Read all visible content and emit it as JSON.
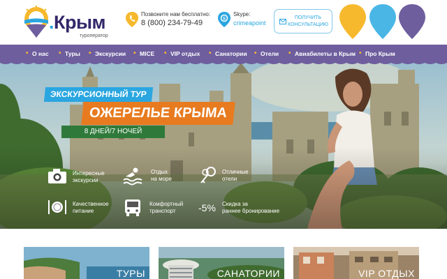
{
  "brand": {
    "name": "Крым",
    "tagline": "туроператор"
  },
  "contacts": {
    "phone_label": "Позвоните нам бесплатно:",
    "phone": "8 (800) 234-79-49",
    "skype_label": "Skype:",
    "skype": "crimeapoint"
  },
  "consult_button": {
    "line1": "ПОЛУЧИТЬ",
    "line2": "КОНСУЛЬТАЦИЮ"
  },
  "nav": {
    "items": [
      "О нас",
      "Туры",
      "Экскурсии",
      "MICE",
      "VIP отдых",
      "Санатории",
      "Отели",
      "Авиабилеты в Крым",
      "Про Крым"
    ]
  },
  "hero": {
    "label": "ЭКСКУРСИОННЫЙ ТУР",
    "title": "ОЖЕРЕЛЬЕ КРЫМА",
    "duration": "8 ДНЕЙ/7 НОЧЕЙ",
    "features": [
      {
        "icon": "camera-icon",
        "text": "Интересные\nэкскурсии"
      },
      {
        "icon": "swimmer-icon",
        "text": "Отдых\nна море"
      },
      {
        "icon": "keys-icon",
        "text": "Отличные\nотели"
      },
      {
        "icon": "plate-icon",
        "text": "Качественное\nпитание"
      },
      {
        "icon": "bus-icon",
        "text": "Комфортный\nтранспорт"
      },
      {
        "icon": "discount-badge",
        "badge": "-5%",
        "text": "Скидка за\nраннее бронирование"
      }
    ]
  },
  "cards": [
    {
      "label": "ТУРЫ"
    },
    {
      "label": "САНАТОРИИ"
    },
    {
      "label": "VIP ОТДЫХ"
    }
  ],
  "colors": {
    "brand_purple": "#6e5e9e",
    "accent_orange": "#e87b1f",
    "accent_blue": "#2aa6e0",
    "accent_yellow": "#f6b92e",
    "accent_green": "#2f7a3a"
  }
}
